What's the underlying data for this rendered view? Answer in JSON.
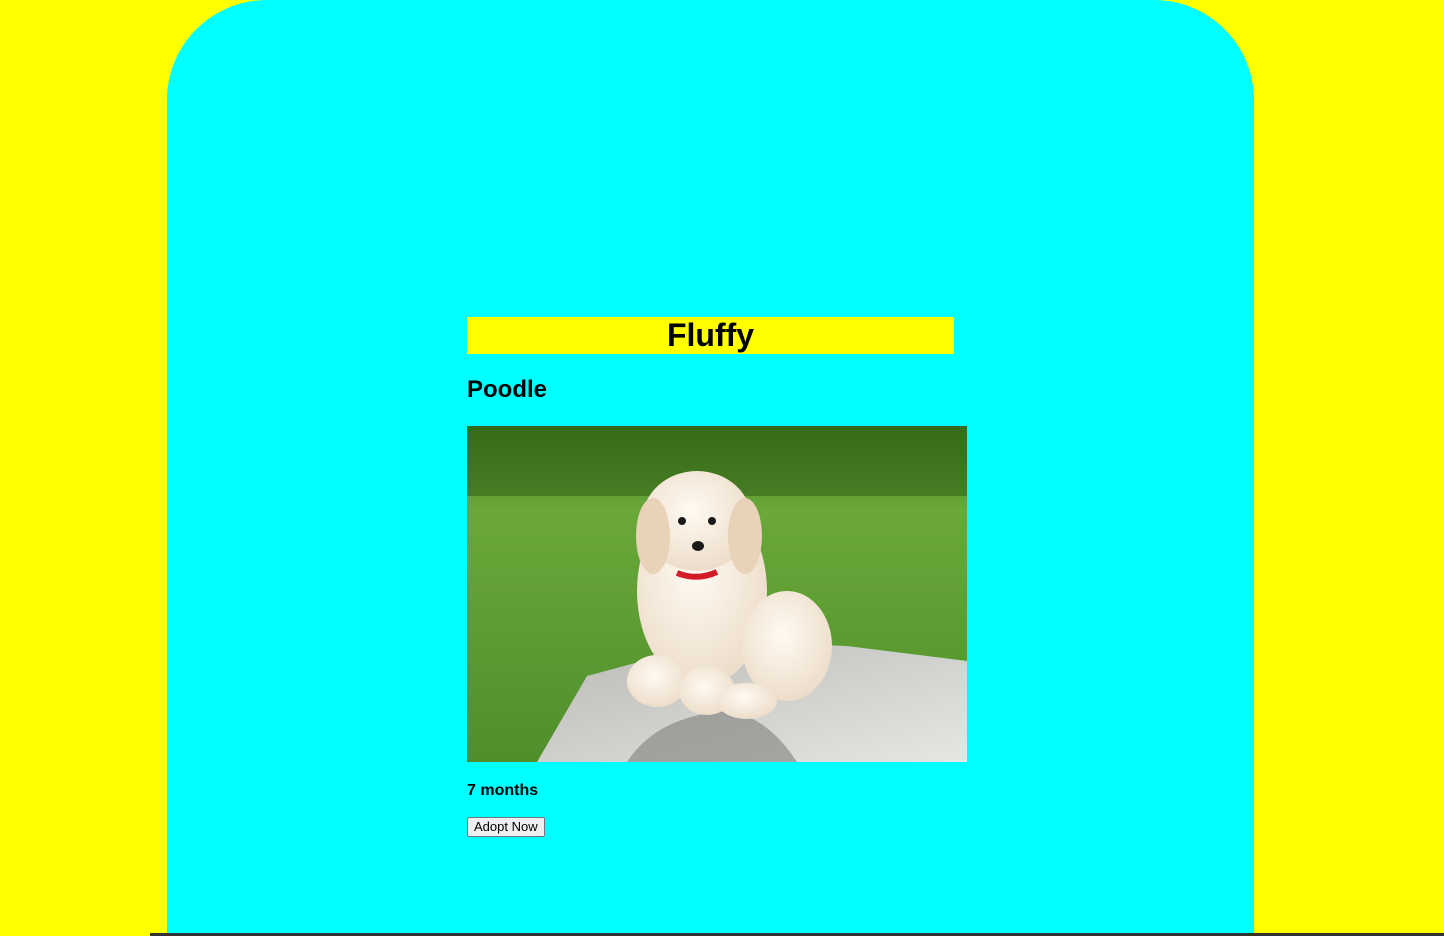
{
  "pet": {
    "name": "Fluffy",
    "breed": "Poodle",
    "age": "7 months",
    "photo_icon": "dog-photo"
  },
  "actions": {
    "adopt_label": "Adopt Now"
  },
  "colors": {
    "page_background": "#ffff00",
    "panel_background": "#00ffff",
    "title_highlight": "#ffff00"
  }
}
